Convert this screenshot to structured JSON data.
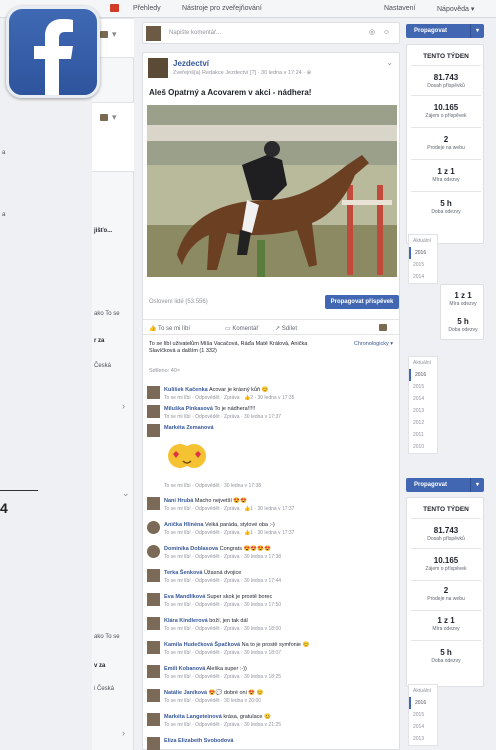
{
  "topbar": {
    "tab_overview": "Přehledy",
    "tab_publishing": "Nástroje pro zveřejňování",
    "settings": "Nastavení",
    "help": "Nápověda ▾"
  },
  "composer": {
    "placeholder": "Napište komentář..."
  },
  "left": {
    "item1": "jišťo...",
    "item2": "ako To se",
    "item3": "r za",
    "item4": "Česká",
    "item5": "ako To se",
    "item6": "v za",
    "item7": "i Česká",
    "page_num": "4",
    "far1": "a",
    "far2": "a"
  },
  "post": {
    "page_name": "Jezdectví",
    "meta": "Zveřejnil(a) Redakce Jezdectví [?] · 30 ledna v 17:24 · ⊕",
    "text": "Aleš Opatrný a Acovarem v akci - nádhera!",
    "reach": "Oslovení lidé (53.556)",
    "promote_label": "Propagovat příspěvek",
    "like": "To se mi líbí",
    "comment": "Komentář",
    "share": "Sdílet",
    "likes_line1": "To se líbí uživatelům Míša Vacačová, Ráďa Matě Králová, Anička",
    "likes_line2": "Slavíčková a dalším (1 332)",
    "order": "Chronologicky ▾",
    "shared": "Sdíleno: 40×"
  },
  "comments": [
    {
      "name": "Kulíšek Kačenka",
      "text": "Acovar je krásný kůň 😊",
      "meta": "To se mi líbí · Odpovědět · Zpráva · 👍2 · 30 ledna v 17:35"
    },
    {
      "name": "Miluška Pinkasová",
      "text": "To je nádhera!!!!!",
      "meta": "To se mi líbí · Odpovědět · Zpráva · 30 ledna v 17:37"
    },
    {
      "name": "Markéta Zemanová",
      "text": "",
      "meta": "To se mi líbí · Odpovědět · 30 ledna v 17:38"
    },
    {
      "name": "Nani Hrubá",
      "text": "Macho nejvetší 😍😍",
      "meta": "To se mi líbí · Odpovědět · Zpráva · 👍1 · 30 ledna v 17:37"
    },
    {
      "name": "Anička Hlinéna",
      "text": "Velká paráda, stylové oba :-)",
      "meta": "To se mi líbí · Odpovědět · Zpráva · 👍1 · 30 ledna v 17:37"
    },
    {
      "name": "Dominika Doblasova",
      "text": "Congrats 😍😍😍😍",
      "meta": "To se mi líbí · Odpovědět · Zpráva · 30 ledna v 17:38"
    },
    {
      "name": "Terka Šenková",
      "text": "Úžasná dvojice",
      "meta": "To se mi líbí · Odpovědět · Zpráva · 30 ledna v 17:44"
    },
    {
      "name": "Eva Mandlíková",
      "text": "Super skok je prostě borec",
      "meta": "To se mi líbí · Odpovědět · Zpráva · 30 ledna v 17:50"
    },
    {
      "name": "Klára Kindlerová",
      "text": "boží, jen tak dál",
      "meta": "To se mi líbí · Odpovědět · Zpráva · 30 ledna v 18:00"
    },
    {
      "name": "Kamila Hudečková Špačková",
      "text": "Na to je prostě symfonie 😊",
      "meta": "To se mi líbí · Odpovědět · Zpráva · 30 ledna v 18:07"
    },
    {
      "name": "Emili Kobanová",
      "text": "Aleška super :-))",
      "meta": "To se mi líbí · Odpovědět · Zpráva · 30 ledna v 18:25"
    },
    {
      "name": "Natálie Janíková",
      "text": "😍💬 dobré oni 😍 😊",
      "meta": "To se mi líbí · Odpovědět · 30 ledna v 20:00"
    },
    {
      "name": "Markéta Langeteinová",
      "text": "krása, gratulace 😊",
      "meta": "To se mi líbí · Odpovědět · Zpráva · 30 ledna v 21:25"
    },
    {
      "name": "Eliza Elizabeth Svobodová",
      "text": "",
      "meta": ""
    }
  ],
  "sidebar": {
    "promote": "Propagovat",
    "week_title": "TENTO TÝDEN",
    "reach_value": "81.743",
    "reach_label": "Dosah příspěvků",
    "engage_value": "10.165",
    "engage_label": "Zájem o příspěvek",
    "views_value": "2",
    "views_label": "Prodeje na webu",
    "resp_value": "1 z 1",
    "resp_label": "Míra odezvy",
    "time_value": "5 h",
    "time_label": "Doba odezvy",
    "years_a": [
      "Aktuální",
      "2016",
      "2015",
      "2014"
    ],
    "years_b": [
      "Aktuální",
      "2016",
      "2015",
      "2014",
      "2013",
      "2012",
      "2011",
      "2010"
    ],
    "years_c": [
      "Aktuální",
      "2016",
      "2015",
      "2014",
      "2013"
    ],
    "mini1_value": "1 z 1",
    "mini1_label": "Míra odezvy",
    "mini2_value": "5 h",
    "mini2_label": "Doba odezvy",
    "promote2": "Propagovat",
    "week_title2": "TENTO TÝDEN",
    "reach_value2": "81.743",
    "reach_label2": "Dosah příspěvků",
    "engage_value2": "10.165",
    "engage_label2": "Zájem o příspěvek",
    "views_value2": "2",
    "views_label2": "Prodeje na webu",
    "resp_value2": "1 z 1",
    "resp_label2": "Míra odezvy",
    "time_value2": "5 h",
    "time_label2": "Doba odezvy"
  },
  "colors": {
    "brand": "#4267b2",
    "link": "#365899",
    "logo": "#3b5998"
  }
}
